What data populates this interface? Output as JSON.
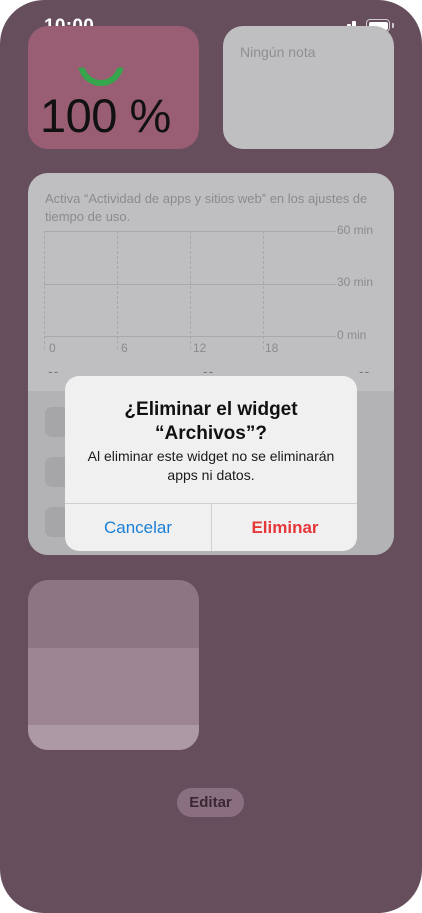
{
  "status_bar": {
    "time": "10:00",
    "signal_icon": "signal-bars-icon",
    "battery_icon": "battery-full-icon"
  },
  "widgets": {
    "battery": {
      "percent": "100 %",
      "ring_color": "#35a64c"
    },
    "note": {
      "text": "Ningún nota"
    },
    "screen_time": {
      "message": "Activa “Actividad de apps y sitios web” en los ajustes de tiempo de uso.",
      "y_labels": [
        "60 min",
        "30 min",
        "0 min"
      ],
      "x_labels": [
        "0",
        "6",
        "12",
        "18"
      ],
      "placeholders": [
        "--",
        "--",
        "--"
      ]
    }
  },
  "edit_button": {
    "label": "Editar"
  },
  "alert": {
    "title": "¿Eliminar el widget “Archivos”?",
    "message": "Al eliminar este widget no se eliminarán apps ni datos.",
    "cancel_label": "Cancelar",
    "delete_label": "Eliminar",
    "cancel_color": "#1a7fd6",
    "delete_color": "#e5383b"
  },
  "colors": {
    "background": "#664e5c",
    "widget_gray": "#bfbfc1",
    "battery_widget": "#995e74"
  }
}
